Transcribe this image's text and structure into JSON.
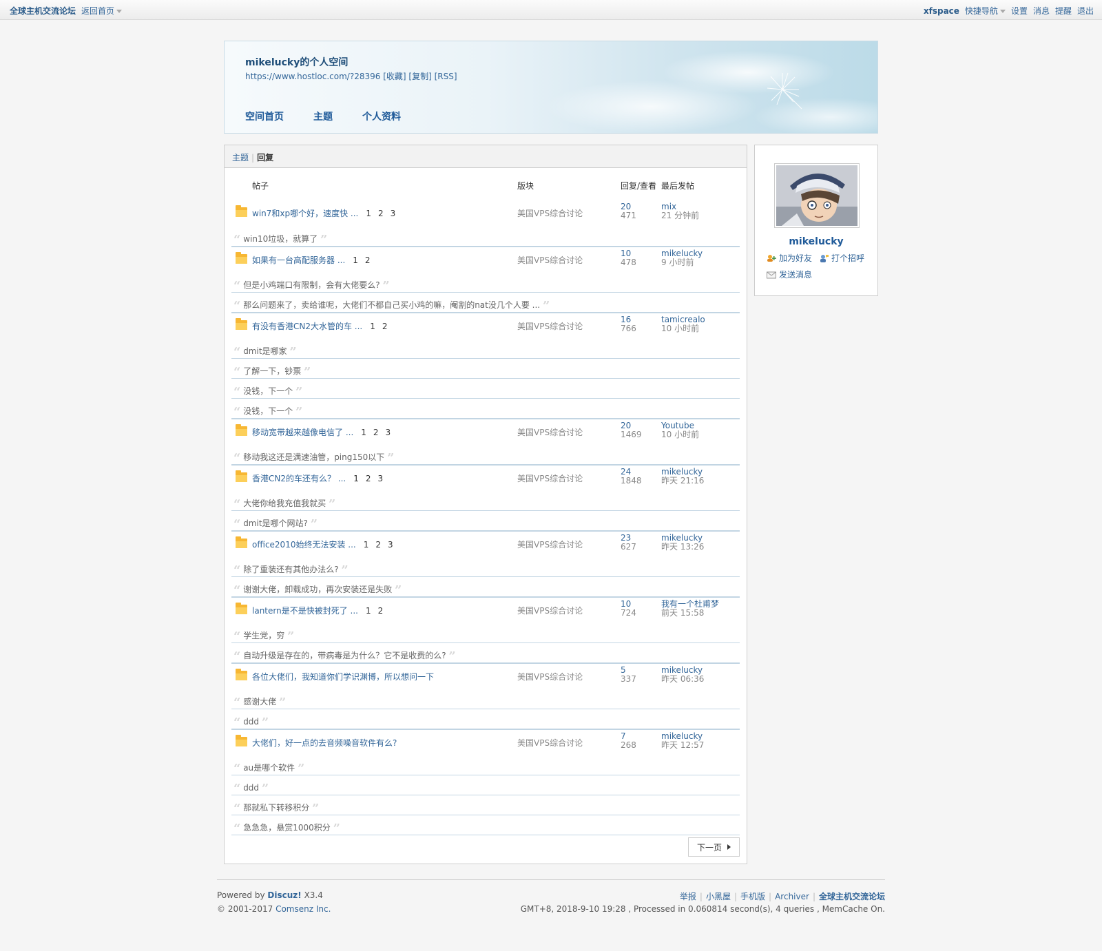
{
  "topbar": {
    "site_name": "全球主机交流论坛",
    "home_link": "返回首页",
    "username": "xfspace",
    "quick_nav": "快捷导航",
    "settings": "设置",
    "messages": "消息",
    "reminders": "提醒",
    "logout": "退出"
  },
  "header": {
    "space_title": "mikelucky的个人空间",
    "space_url": "https://www.hostloc.com/?28396",
    "favorite": "[收藏]",
    "copy": "[复制]",
    "rss": "[RSS]",
    "nav": [
      "空间首页",
      "主题",
      "个人资料"
    ]
  },
  "tabs": {
    "threads": "主题",
    "replies": "回复"
  },
  "columns": {
    "post": "帖子",
    "forum": "版块",
    "reply_view": "回复/查看",
    "last_post": "最后发帖"
  },
  "threads": [
    {
      "title": "win7和xp哪个好，速度快 ...",
      "pages": [
        "1",
        "2",
        "3"
      ],
      "forum": "美国VPS综合讨论",
      "replies": "20",
      "views": "471",
      "last_user": "mix",
      "last_time": "21 分钟前",
      "quotes": [
        "win10垃圾，就算了"
      ]
    },
    {
      "title": "如果有一台高配服务器 ...",
      "pages": [
        "1",
        "2"
      ],
      "forum": "美国VPS综合讨论",
      "replies": "10",
      "views": "478",
      "last_user": "mikelucky",
      "last_time": "9 小时前",
      "quotes": [
        "但是小鸡端口有限制，会有大佬要么?",
        "那么问题来了，卖给谁呢，大佬们不都自己买小鸡的嘛，阉割的nat没几个人要 ..."
      ]
    },
    {
      "title": "有没有香港CN2大水管的车 ...",
      "pages": [
        "1",
        "2"
      ],
      "forum": "美国VPS综合讨论",
      "replies": "16",
      "views": "766",
      "last_user": "tamicrealo",
      "last_time": "10 小时前",
      "quotes": [
        "dmit是哪家",
        "了解一下，钞票",
        "没钱，下一个",
        "没钱，下一个"
      ]
    },
    {
      "title": "移动宽带越来越像电信了 ...",
      "pages": [
        "1",
        "2",
        "3"
      ],
      "forum": "美国VPS综合讨论",
      "replies": "20",
      "views": "1469",
      "last_user": "Youtube",
      "last_time": "10 小时前",
      "quotes": [
        "移动我这还是满速油管，ping150以下"
      ]
    },
    {
      "title": "香港CN2的车还有么？ ...",
      "pages": [
        "1",
        "2",
        "3"
      ],
      "forum": "美国VPS综合讨论",
      "replies": "24",
      "views": "1848",
      "last_user": "mikelucky",
      "last_time": "昨天 21:16",
      "quotes": [
        "大佬你给我充值我就买",
        "dmit是哪个网站?"
      ]
    },
    {
      "title": "office2010始终无法安装 ...",
      "pages": [
        "1",
        "2",
        "3"
      ],
      "forum": "美国VPS综合讨论",
      "replies": "23",
      "views": "627",
      "last_user": "mikelucky",
      "last_time": "昨天 13:26",
      "quotes": [
        "除了重装还有其他办法么?",
        "谢谢大佬，卸载成功，再次安装还是失败"
      ]
    },
    {
      "title": "lantern是不是快被封死了 ...",
      "pages": [
        "1",
        "2"
      ],
      "forum": "美国VPS综合讨论",
      "replies": "10",
      "views": "724",
      "last_user": "我有一个杜甫梦",
      "last_time": "前天 15:58",
      "quotes": [
        "学生党，穷",
        "自动升级是存在的，带病毒是为什么？它不是收费的么?"
      ]
    },
    {
      "title": "各位大佬们，我知道你们学识渊博，所以想问一下",
      "pages": [],
      "forum": "美国VPS综合讨论",
      "replies": "5",
      "views": "337",
      "last_user": "mikelucky",
      "last_time": "昨天 06:36",
      "quotes": [
        "感谢大佬",
        "ddd"
      ]
    },
    {
      "title": "大佬们，好一点的去音频噪音软件有么?",
      "pages": [],
      "forum": "美国VPS综合讨论",
      "replies": "7",
      "views": "268",
      "last_user": "mikelucky",
      "last_time": "昨天 12:57",
      "quotes": [
        "au是哪个软件",
        "ddd",
        "那就私下转移积分",
        "急急急，悬赏1000积分"
      ]
    }
  ],
  "pager": {
    "next": "下一页"
  },
  "profile": {
    "username": "mikelucky",
    "add_friend": "加为好友",
    "greet": "打个招呼",
    "send_message": "发送消息"
  },
  "footer": {
    "powered_by": "Powered by",
    "discuz": "Discuz!",
    "version": "X3.4",
    "copyright": "© 2001-2017",
    "comsenz": "Comsenz Inc.",
    "links": [
      "举报",
      "小黑屋",
      "手机版",
      "Archiver",
      "全球主机交流论坛"
    ],
    "stats": "GMT+8, 2018-9-10 19:28 , Processed in 0.060814 second(s), 4 queries , MemCache On."
  }
}
